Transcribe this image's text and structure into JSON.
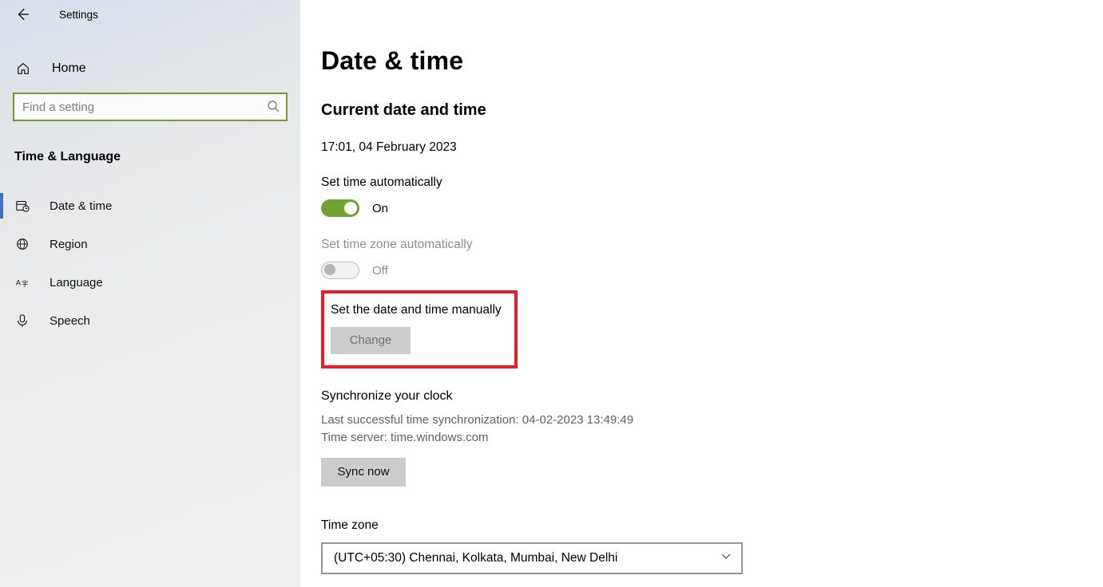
{
  "header": {
    "title": "Settings"
  },
  "home_label": "Home",
  "search": {
    "placeholder": "Find a setting"
  },
  "section_label": "Time & Language",
  "nav": [
    {
      "id": "date-time",
      "label": "Date & time",
      "active": true
    },
    {
      "id": "region",
      "label": "Region"
    },
    {
      "id": "language",
      "label": "Language"
    },
    {
      "id": "speech",
      "label": "Speech"
    }
  ],
  "page": {
    "title": "Date & time",
    "current_heading": "Current date and time",
    "current_value": "17:01, 04 February 2023",
    "auto_time": {
      "label": "Set time automatically",
      "state": "On",
      "on": true
    },
    "auto_zone": {
      "label": "Set time zone automatically",
      "state": "Off",
      "on": false,
      "disabled": true
    },
    "manual": {
      "label": "Set the date and time manually",
      "button": "Change",
      "disabled": true
    },
    "sync": {
      "heading": "Synchronize your clock",
      "last_line": "Last successful time synchronization: 04-02-2023 13:49:49",
      "server_line": "Time server: time.windows.com",
      "button": "Sync now"
    },
    "timezone": {
      "label": "Time zone",
      "value": "(UTC+05:30) Chennai, Kolkata, Mumbai, New Delhi"
    }
  }
}
